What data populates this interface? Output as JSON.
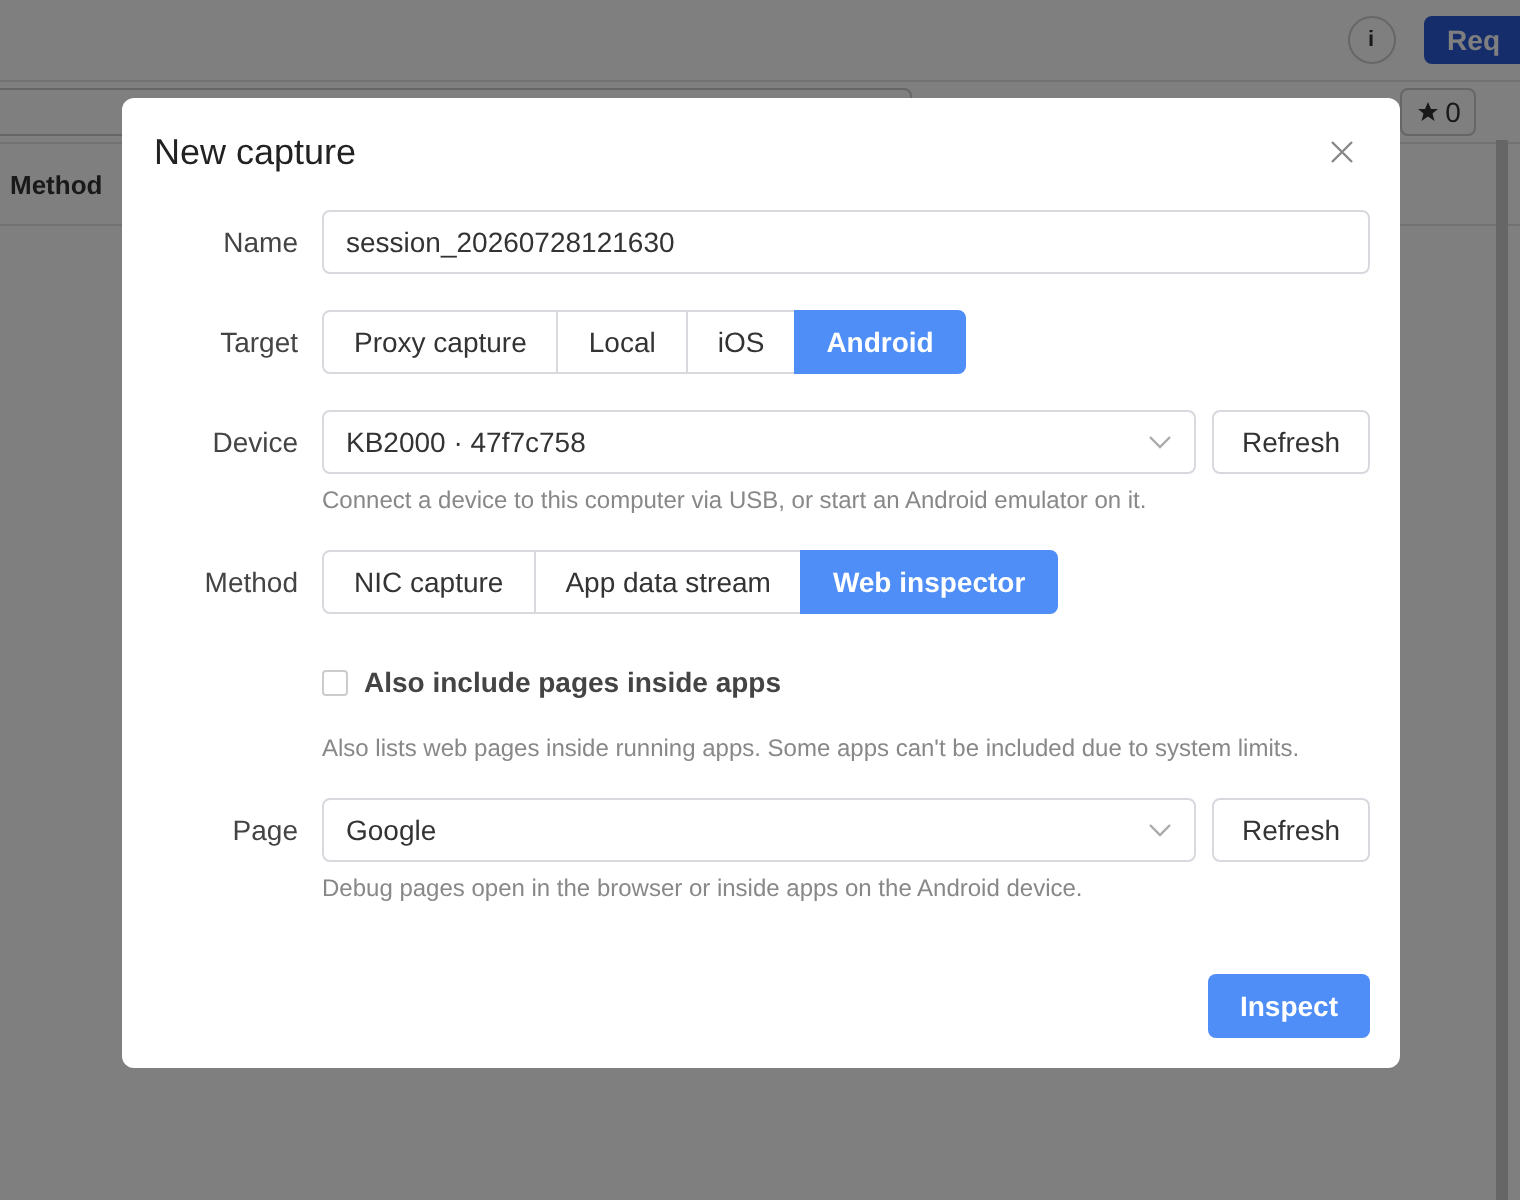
{
  "background": {
    "info_button": "i",
    "request_button": "Req",
    "star_count": "0",
    "column_header": "Method"
  },
  "dialog": {
    "title": "New capture",
    "name": {
      "label": "Name",
      "value": "session_20260728121630"
    },
    "target": {
      "label": "Target",
      "options": [
        {
          "label": "Proxy capture",
          "selected": false
        },
        {
          "label": "Local",
          "selected": false
        },
        {
          "label": "iOS",
          "selected": false
        },
        {
          "label": "Android",
          "selected": true
        }
      ]
    },
    "device": {
      "label": "Device",
      "value": "KB2000 · 47f7c758",
      "button": "Refresh",
      "hint": "Connect a device to this computer via USB, or start an Android emulator on it."
    },
    "method": {
      "label": "Method",
      "options": [
        {
          "label": "NIC capture",
          "selected": false
        },
        {
          "label": "App data stream",
          "selected": false
        },
        {
          "label": "Web inspector",
          "selected": true
        }
      ]
    },
    "include_apps": {
      "label": "Also include pages inside apps",
      "checked": false,
      "hint": "Also lists web pages inside running apps. Some apps can't be included due to system limits."
    },
    "page": {
      "label": "Page",
      "value": "Google",
      "button": "Refresh",
      "hint": "Debug pages open in the browser or inside apps on the Android device."
    },
    "primary_button": "Inspect"
  }
}
